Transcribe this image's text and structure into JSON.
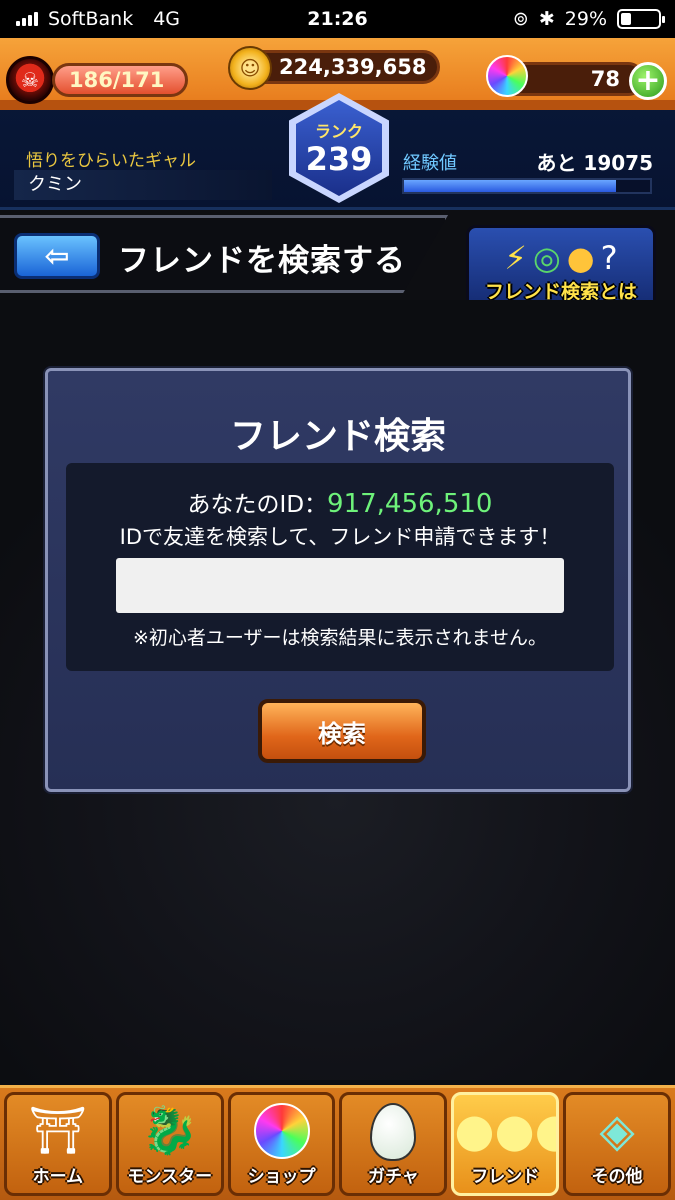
{
  "status_bar": {
    "carrier": "SoftBank",
    "network": "4G",
    "time": "21:26",
    "battery_percent": "29%",
    "battery_level": 0.29
  },
  "hud": {
    "stamina": "186/171",
    "gold": "224,339,658",
    "orbs": "78",
    "rank_label": "ランク",
    "rank_value": "239",
    "player_title": "悟りをひらいたギャル",
    "player_name": "クミン",
    "exp_label": "経験値",
    "exp_remaining": "あと 19075",
    "exp_progress": 0.86
  },
  "header": {
    "title": "フレンドを検索する",
    "help_label": "フレンド検索とは"
  },
  "panel": {
    "title": "フレンド検索",
    "id_label": "あなたのID：",
    "id_value": "917,456,510",
    "description": "IDで友達を検索して、フレンド申請できます！",
    "input_value": "",
    "note": "※初心者ユーザーは検索結果に表示されません。",
    "search_button": "検索"
  },
  "nav": {
    "items": [
      {
        "label": "ホーム",
        "icon": "home-gate-icon"
      },
      {
        "label": "モンスター",
        "icon": "dragon-icon"
      },
      {
        "label": "ショップ",
        "icon": "rainbow-orb-icon"
      },
      {
        "label": "ガチャ",
        "icon": "egg-icon"
      },
      {
        "label": "フレンド",
        "icon": "friends-icon",
        "active": true
      },
      {
        "label": "その他",
        "icon": "other-icon"
      }
    ]
  },
  "colors": {
    "id_value": "#6ef27a",
    "accent_orange": "#e6781a",
    "panel_bg": "#303a64",
    "exp_fill": "#2a5ae0"
  }
}
